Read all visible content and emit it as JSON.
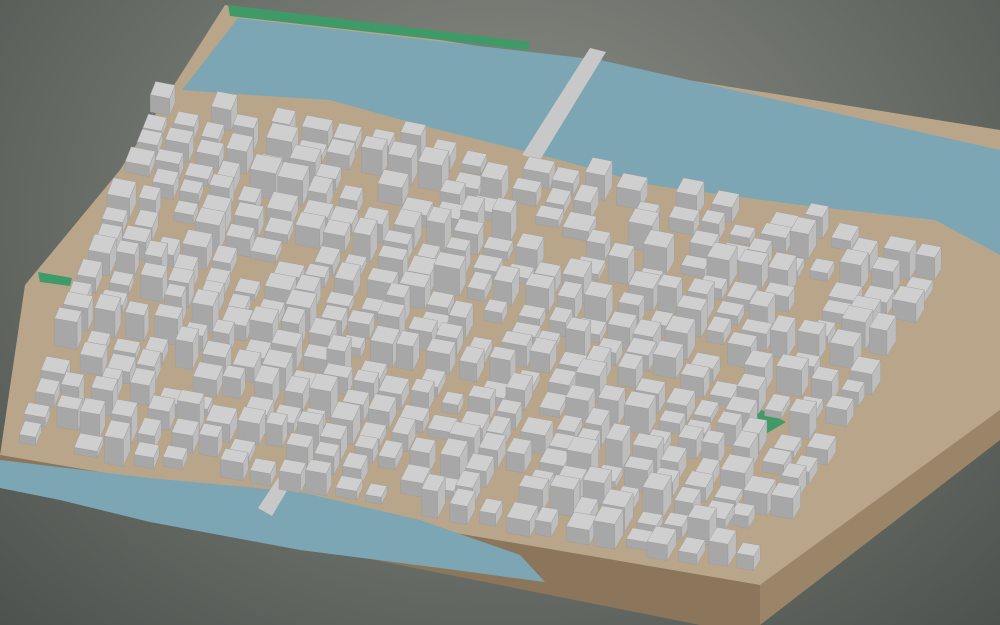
{
  "viewport": {
    "background_color": "#7a7e78"
  },
  "scene": {
    "ground_color": "#b9a68a",
    "base_side_color": "#9b8568",
    "base_front_color": "#8b765b",
    "water_color": "#7ca6b4",
    "green_color": "#3f9a68",
    "building_color": "#cfcfcf",
    "building_shadow_color": "#a7a7a7",
    "bridge_color": "#c8c8c8"
  }
}
